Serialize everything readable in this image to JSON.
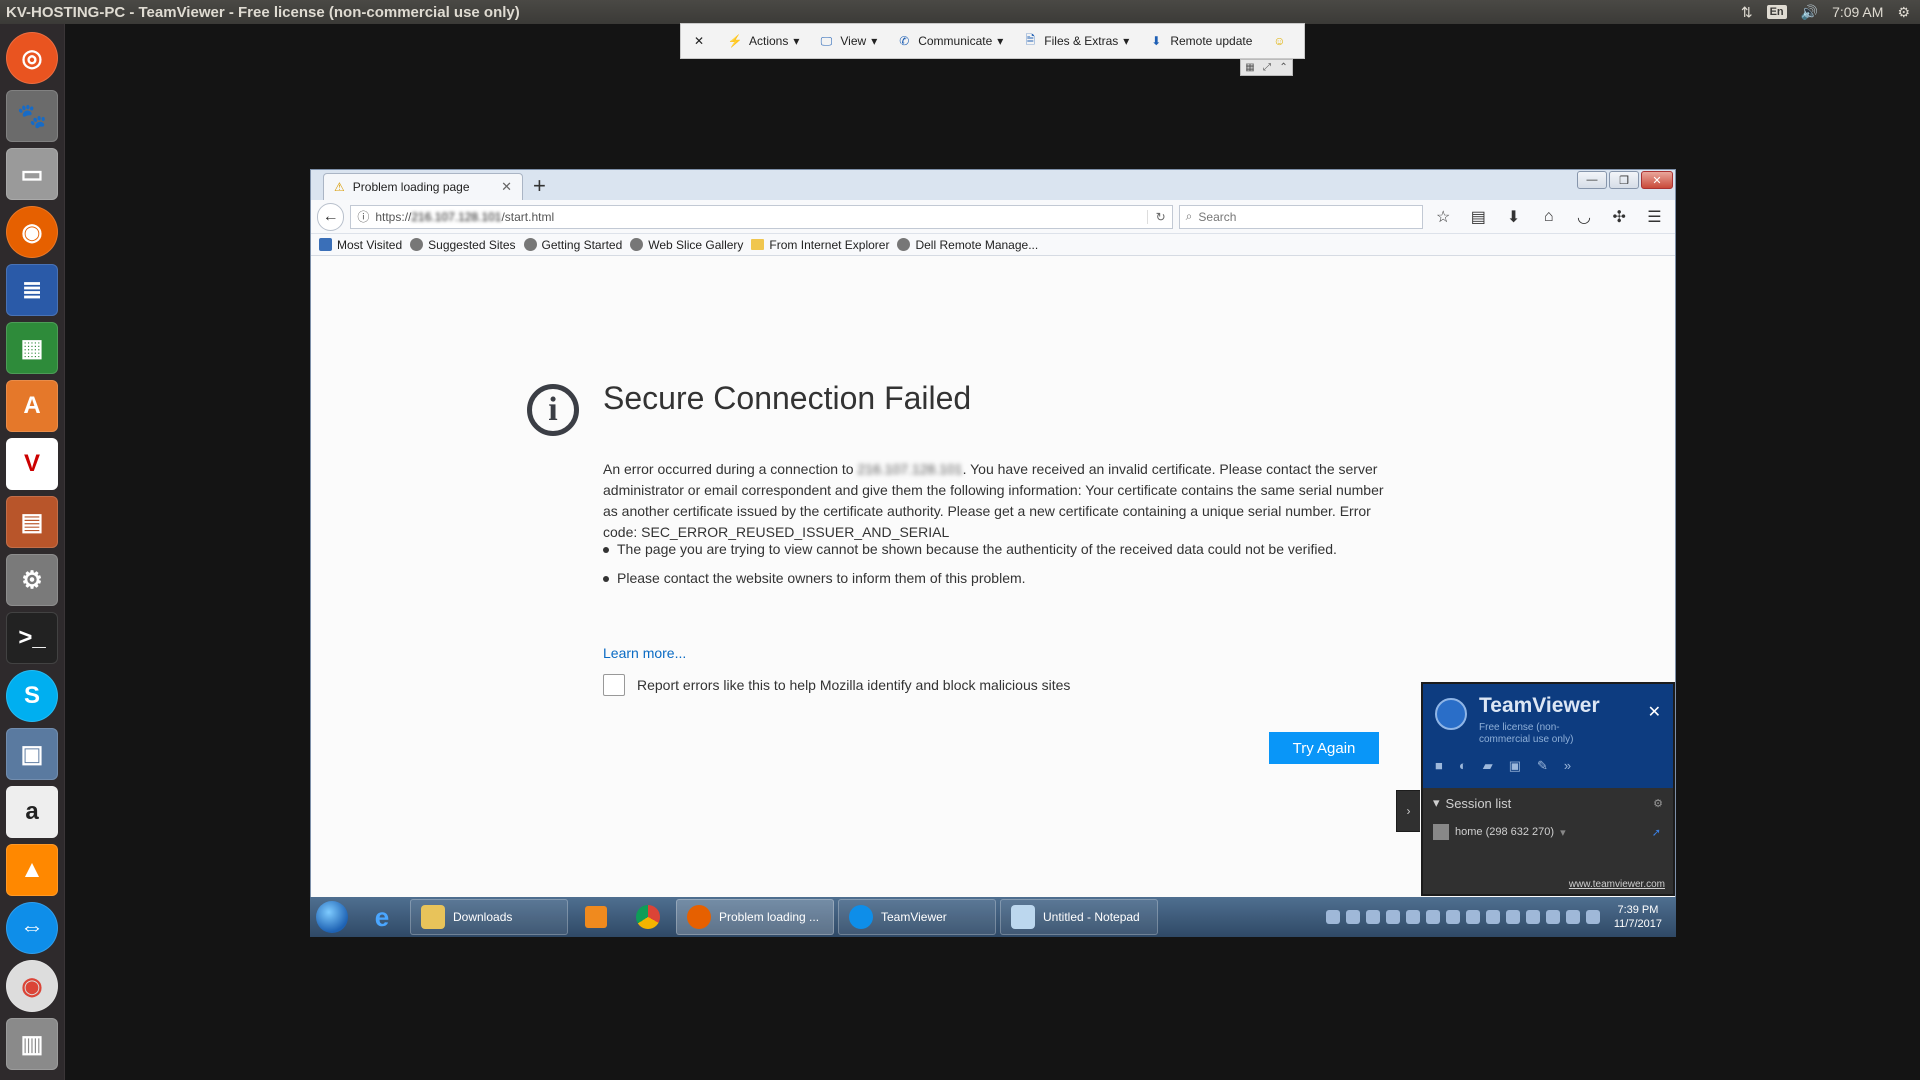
{
  "os": {
    "window_title": "KV-HOSTING-PC - TeamViewer - Free license (non-commercial use only)",
    "lang": "En",
    "time": "7:09 AM"
  },
  "teamviewer_toolbar": {
    "actions": "Actions",
    "view": "View",
    "communicate": "Communicate",
    "files_extras": "Files & Extras",
    "remote_update": "Remote update"
  },
  "browser": {
    "tab_title": "Problem loading page",
    "url_prefix": "https://",
    "url_host": "216.107.128.101",
    "url_path": "/start.html",
    "search_placeholder": "Search",
    "bookmarks": [
      "Most Visited",
      "Suggested Sites",
      "Getting Started",
      "Web Slice Gallery",
      "From Internet Explorer",
      "Dell Remote Manage..."
    ]
  },
  "error_page": {
    "title": "Secure Connection Failed",
    "desc_before": "An error occurred during a connection to ",
    "desc_host": "216.107.128.101",
    "desc_after": ". You have received an invalid certificate. Please contact the server administrator or email correspondent and give them the following information: Your certificate contains the same serial number as another certificate issued by the certificate authority. Please get a new certificate containing a unique serial number. Error code: SEC_ERROR_REUSED_ISSUER_AND_SERIAL",
    "bullets": [
      "The page you are trying to view cannot be shown because the authenticity of the received data could not be verified.",
      "Please contact the website owners to inform them of this problem."
    ],
    "learn_more": "Learn more...",
    "report_label": "Report errors like this to help Mozilla identify and block malicious sites",
    "try_again": "Try Again"
  },
  "tv_panel": {
    "name": "TeamViewer",
    "license": "Free license (non-commercial use only)",
    "session_list": "Session list",
    "home": "home (298 632 270)",
    "link": "www.teamviewer.com"
  },
  "win_taskbar": {
    "downloads": "Downloads",
    "firefox": "Problem loading ...",
    "teamviewer": "TeamViewer",
    "notepad": "Untitled - Notepad",
    "time": "7:39 PM",
    "date": "11/7/2017"
  },
  "colors": {
    "accent": "#0996f8",
    "tv_blue": "#0d3c80"
  }
}
